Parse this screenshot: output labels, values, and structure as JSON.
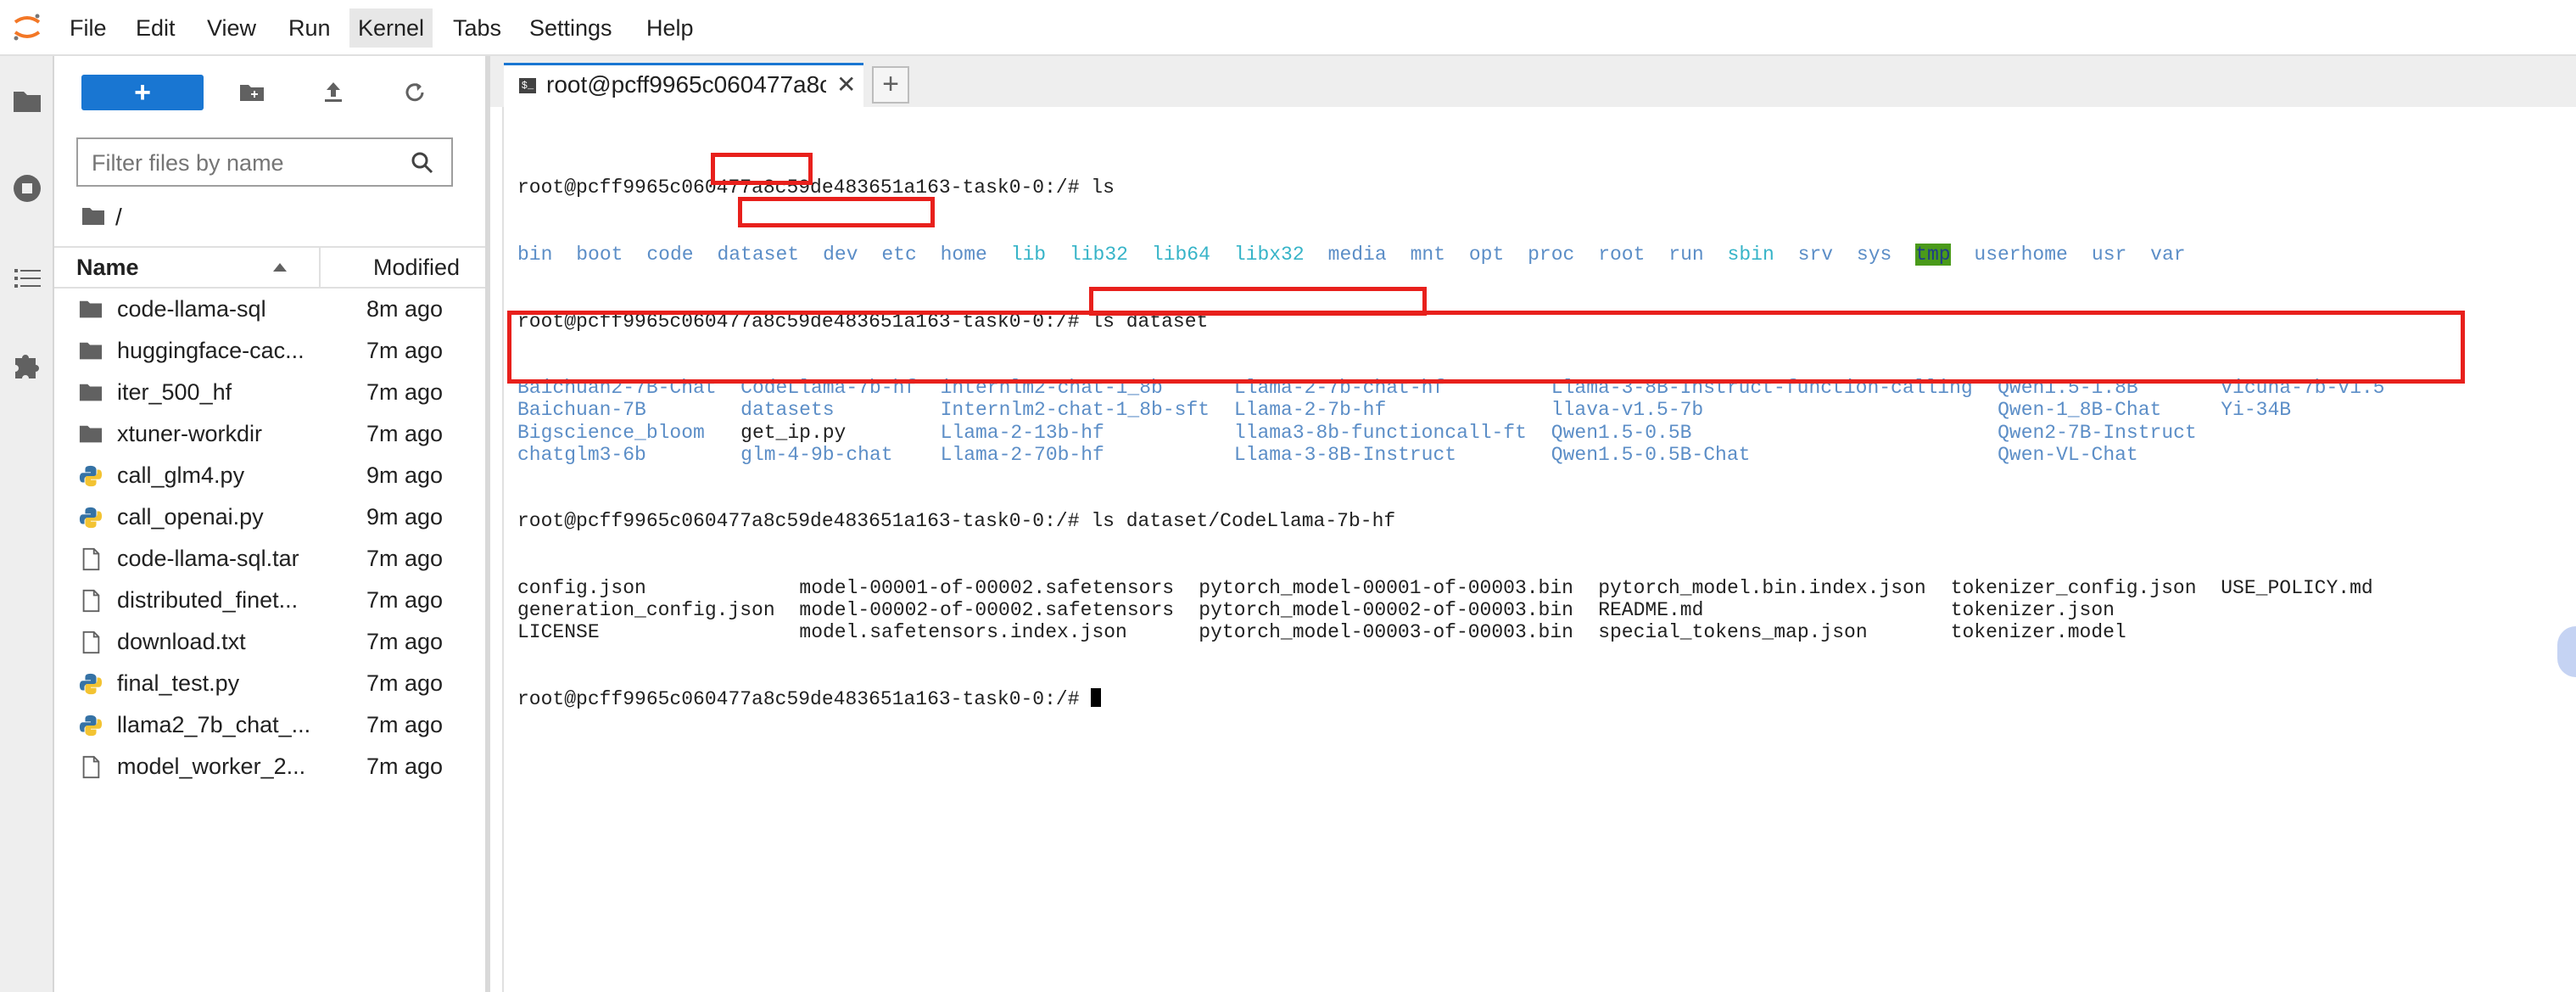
{
  "menu": [
    "File",
    "Edit",
    "View",
    "Run",
    "Kernel",
    "Tabs",
    "Settings",
    "Help"
  ],
  "active_menu": "Kernel",
  "filebrowser": {
    "new_label": "+",
    "filter_placeholder": "Filter files by name",
    "path": "/",
    "col_name": "Name",
    "col_modified": "Modified",
    "items": [
      {
        "name": "code-llama-sql",
        "time": "8m ago",
        "icon": "folder-icon"
      },
      {
        "name": "huggingface-cac...",
        "time": "7m ago",
        "icon": "folder-icon"
      },
      {
        "name": "iter_500_hf",
        "time": "7m ago",
        "icon": "folder-icon"
      },
      {
        "name": "xtuner-workdir",
        "time": "7m ago",
        "icon": "folder-icon"
      },
      {
        "name": "call_glm4.py",
        "time": "9m ago",
        "icon": "python-icon"
      },
      {
        "name": "call_openai.py",
        "time": "9m ago",
        "icon": "python-icon"
      },
      {
        "name": "code-llama-sql.tar",
        "time": "7m ago",
        "icon": "file-icon"
      },
      {
        "name": "distributed_finet...",
        "time": "7m ago",
        "icon": "file-icon"
      },
      {
        "name": "download.txt",
        "time": "7m ago",
        "icon": "file-icon"
      },
      {
        "name": "final_test.py",
        "time": "7m ago",
        "icon": "python-icon"
      },
      {
        "name": "llama2_7b_chat_...",
        "time": "7m ago",
        "icon": "python-icon"
      },
      {
        "name": "model_worker_2...",
        "time": "7m ago",
        "icon": "file-icon"
      }
    ]
  },
  "tab": {
    "title": "root@pcff9965c060477a8c",
    "close": "✕",
    "add": "+"
  },
  "terminal": {
    "prompt1": "root@pcff9965c060477a8c59de483651a163-task0-0:/# ls",
    "ls_root": [
      {
        "t": "bin",
        "c": "blue"
      },
      {
        "t": "boot",
        "c": "blue"
      },
      {
        "t": "code",
        "c": "blue"
      },
      {
        "t": "dataset",
        "c": "blue"
      },
      {
        "t": "dev",
        "c": "blue"
      },
      {
        "t": "etc",
        "c": "blue"
      },
      {
        "t": "home",
        "c": "blue"
      },
      {
        "t": "lib",
        "c": "cyan"
      },
      {
        "t": "lib32",
        "c": "cyan"
      },
      {
        "t": "lib64",
        "c": "cyan"
      },
      {
        "t": "libx32",
        "c": "cyan"
      },
      {
        "t": "media",
        "c": "blue"
      },
      {
        "t": "mnt",
        "c": "blue"
      },
      {
        "t": "opt",
        "c": "blue"
      },
      {
        "t": "proc",
        "c": "blue"
      },
      {
        "t": "root",
        "c": "blue"
      },
      {
        "t": "run",
        "c": "blue"
      },
      {
        "t": "sbin",
        "c": "cyan"
      },
      {
        "t": "srv",
        "c": "blue"
      },
      {
        "t": "sys",
        "c": "blue"
      },
      {
        "t": "tmp",
        "c": "tmp"
      },
      {
        "t": "userhome",
        "c": "blue"
      },
      {
        "t": "usr",
        "c": "blue"
      },
      {
        "t": "var",
        "c": "blue"
      }
    ],
    "prompt2": "root@pcff9965c060477a8c59de483651a163-task0-0:/# ls dataset",
    "ls_dataset": [
      [
        {
          "t": "Baichuan2-7B-Chat",
          "c": "blue"
        },
        {
          "t": "CodeLlama-7b-hf",
          "c": "blue"
        },
        {
          "t": "internlm2-chat-1_8b",
          "c": "blue"
        },
        {
          "t": "Llama-2-7b-chat-hf",
          "c": "blue"
        },
        {
          "t": "Llama-3-8B-Instruct-function-calling",
          "c": "blue"
        },
        {
          "t": "Qwen1.5-1.8B",
          "c": "blue"
        },
        {
          "t": "vicuna-7b-v1.5",
          "c": "blue"
        }
      ],
      [
        {
          "t": "Baichuan-7B",
          "c": "blue"
        },
        {
          "t": "datasets",
          "c": "blue"
        },
        {
          "t": "Internlm2-chat-1_8b-sft",
          "c": "blue"
        },
        {
          "t": "Llama-2-7b-hf",
          "c": "blue"
        },
        {
          "t": "llava-v1.5-7b",
          "c": "blue"
        },
        {
          "t": "Qwen-1_8B-Chat",
          "c": "blue"
        },
        {
          "t": "Yi-34B",
          "c": "blue"
        }
      ],
      [
        {
          "t": "Bigscience_bloom",
          "c": "blue"
        },
        {
          "t": "get_ip.py",
          "c": "plain"
        },
        {
          "t": "Llama-2-13b-hf",
          "c": "blue"
        },
        {
          "t": "llama3-8b-functioncall-ft",
          "c": "blue"
        },
        {
          "t": "Qwen1.5-0.5B",
          "c": "blue"
        },
        {
          "t": "Qwen2-7B-Instruct",
          "c": "blue"
        },
        {
          "t": "",
          "c": "plain"
        }
      ],
      [
        {
          "t": "chatglm3-6b",
          "c": "blue"
        },
        {
          "t": "glm-4-9b-chat",
          "c": "blue"
        },
        {
          "t": "Llama-2-70b-hf",
          "c": "blue"
        },
        {
          "t": "Llama-3-8B-Instruct",
          "c": "blue"
        },
        {
          "t": "Qwen1.5-0.5B-Chat",
          "c": "blue"
        },
        {
          "t": "Qwen-VL-Chat",
          "c": "blue"
        },
        {
          "t": "",
          "c": "plain"
        }
      ]
    ],
    "prompt3_prefix": "root@pcff9965c060477a8c59de483651a163-task0-0:/# ",
    "prompt3_cmd": "ls dataset/CodeLlama-7b-hf",
    "ls_codellama": [
      [
        "config.json",
        "model-00001-of-00002.safetensors",
        "pytorch_model-00001-of-00003.bin",
        "pytorch_model.bin.index.json",
        "tokenizer_config.json",
        "USE_POLICY.md"
      ],
      [
        "generation_config.json",
        "model-00002-of-00002.safetensors",
        "pytorch_model-00002-of-00003.bin",
        "README.md",
        "tokenizer.json",
        ""
      ],
      [
        "LICENSE",
        "model.safetensors.index.json",
        "pytorch_model-00003-of-00003.bin",
        "special_tokens_map.json",
        "tokenizer.model",
        ""
      ]
    ],
    "prompt4": "root@pcff9965c060477a8c59de483651a163-task0-0:/# "
  },
  "colors": {
    "accent": "#1976d2",
    "dir_blue": "#5c8ec7",
    "link_cyan": "#37b4c8",
    "tmp_bg": "#4a9a1a",
    "annotation_red": "#e8201c"
  }
}
